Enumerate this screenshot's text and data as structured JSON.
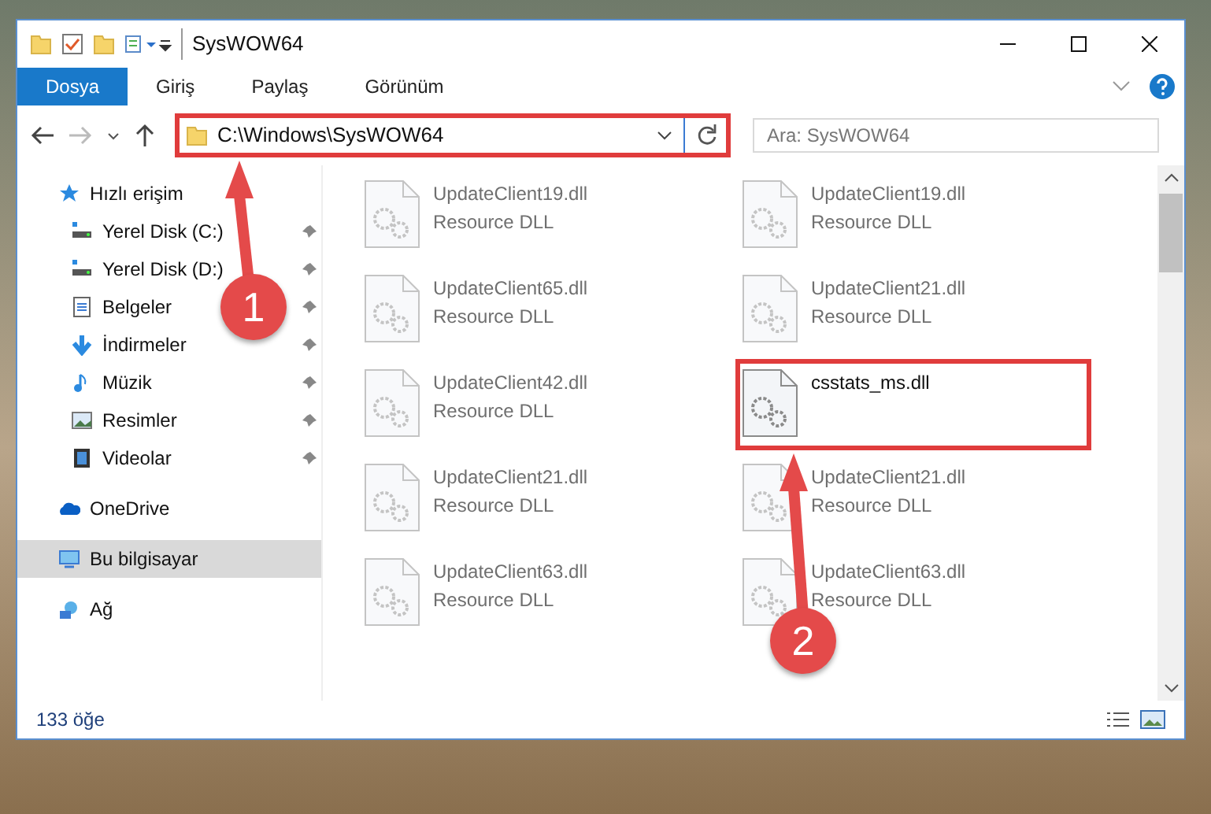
{
  "window": {
    "title": "SysWOW64"
  },
  "ribbon_tabs": [
    {
      "label": "Dosya",
      "selected": true
    },
    {
      "label": "Giriş",
      "selected": false
    },
    {
      "label": "Paylaş",
      "selected": false
    },
    {
      "label": "Görünüm",
      "selected": false
    }
  ],
  "address": {
    "path": "C:\\Windows\\SysWOW64",
    "highlighted": true
  },
  "search": {
    "placeholder": "Ara: SysWOW64"
  },
  "sidebar": {
    "items": [
      {
        "label": "Hızlı erişim",
        "kind": "star",
        "selected": false,
        "children": [
          {
            "label": "Yerel Disk (C:)",
            "kind": "drive",
            "pinned": true,
            "selected": false
          },
          {
            "label": "Yerel Disk (D:)",
            "kind": "drive",
            "pinned": true,
            "selected": false
          },
          {
            "label": "Belgeler",
            "kind": "docs",
            "pinned": true,
            "selected": false
          },
          {
            "label": "İndirmeler",
            "kind": "download",
            "pinned": true,
            "selected": false
          },
          {
            "label": "Müzik",
            "kind": "music",
            "pinned": true,
            "selected": false
          },
          {
            "label": "Resimler",
            "kind": "pictures",
            "pinned": true,
            "selected": false
          },
          {
            "label": "Videolar",
            "kind": "video",
            "pinned": true,
            "selected": false
          }
        ]
      },
      {
        "label": "OneDrive",
        "kind": "cloud",
        "selected": false
      },
      {
        "label": "Bu bilgisayar",
        "kind": "computer",
        "selected": true
      },
      {
        "label": "Ağ",
        "kind": "network",
        "selected": false
      }
    ]
  },
  "files": [
    {
      "name": "UpdateClient19.dll",
      "type": "Resource DLL",
      "blurred": true,
      "highlighted": false
    },
    {
      "name": "UpdateClient19.dll",
      "type": "Resource DLL",
      "blurred": true,
      "highlighted": false
    },
    {
      "name": "UpdateClient65.dll",
      "type": "Resource DLL",
      "blurred": true,
      "highlighted": false
    },
    {
      "name": "UpdateClient21.dll",
      "type": "Resource DLL",
      "blurred": true,
      "highlighted": false
    },
    {
      "name": "UpdateClient42.dll",
      "type": "Resource DLL",
      "blurred": true,
      "highlighted": false
    },
    {
      "name": "csstats_ms.dll",
      "blurred": false,
      "highlighted": true
    },
    {
      "name": "UpdateClient21.dll",
      "type": "Resource DLL",
      "blurred": true,
      "highlighted": false
    },
    {
      "name": "UpdateClient21.dll",
      "type": "Resource DLL",
      "blurred": true,
      "highlighted": false
    },
    {
      "name": "UpdateClient63.dll",
      "type": "Resource DLL",
      "blurred": true,
      "highlighted": false
    },
    {
      "name": "UpdateClient63.dll",
      "type": "Resource DLL",
      "blurred": true,
      "highlighted": false
    }
  ],
  "status_bar": {
    "count": "133 öğe"
  },
  "annotations": [
    {
      "number": "1"
    },
    {
      "number": "2"
    }
  ]
}
